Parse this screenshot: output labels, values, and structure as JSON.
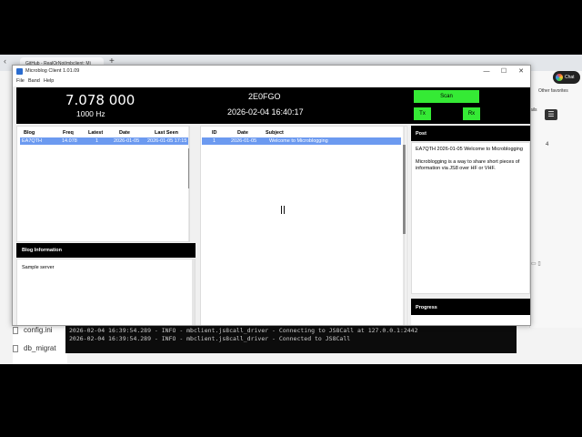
{
  "browser": {
    "tab_label": "GitHub - RealOrNot/mbclient: Mi",
    "new_tab": "+",
    "back": "‹",
    "chat_label": "Chat",
    "favorites_label": "Other favorites",
    "partial_text": "ails",
    "partial_number": "4",
    "files": [
      "config.ini",
      "db_migrat"
    ]
  },
  "terminal": {
    "lines": [
      "2026-02-04 16:39:54.289 - INFO - mbclient.js8call_driver - Connecting to JS8Call at 127.0.0.1:2442",
      "2026-02-04 16:39:54.289 - INFO - mbclient.js8call_driver - Connected to JS8Call"
    ]
  },
  "app": {
    "title": "Microblog Client 1.01.09",
    "window_controls": [
      "—",
      "☐",
      "✕"
    ],
    "menu": [
      "File",
      "Band",
      "Help"
    ],
    "header": {
      "frequency": "7.078 000",
      "step": "1000 Hz",
      "callsign": "2E0FGO",
      "datetime": "2026-02-04 16:40:17",
      "scan_label": "Scan",
      "tx_label": "Tx",
      "rx_label": "Rx",
      "button_color": "#35ea35"
    },
    "blog_table": {
      "columns": [
        "Blog",
        "Freq",
        "Latest",
        "Date",
        "Last Seen"
      ],
      "rows": [
        {
          "blog": "EA7QTH",
          "freq": "14.078",
          "latest": "1",
          "date": "2026-01-05",
          "last_seen": "2026-01-05 17:15"
        }
      ],
      "selected_color": "#6c9af0"
    },
    "blog_info": {
      "title": "Blog Information",
      "text": "Sample server"
    },
    "message_table": {
      "columns": [
        "ID",
        "Date",
        "Subject"
      ],
      "rows": [
        {
          "id": "1",
          "date": "2026-01-05",
          "subject": "Welcome to Microblogging"
        }
      ]
    },
    "post": {
      "title": "Post",
      "heading": "EA7QTH 2026-01-05 Welcome to Microblogging",
      "body": "Microblogging is a way to share short pieces of information via JS8 over HF or VHF."
    },
    "progress": {
      "title": "Progress"
    }
  }
}
